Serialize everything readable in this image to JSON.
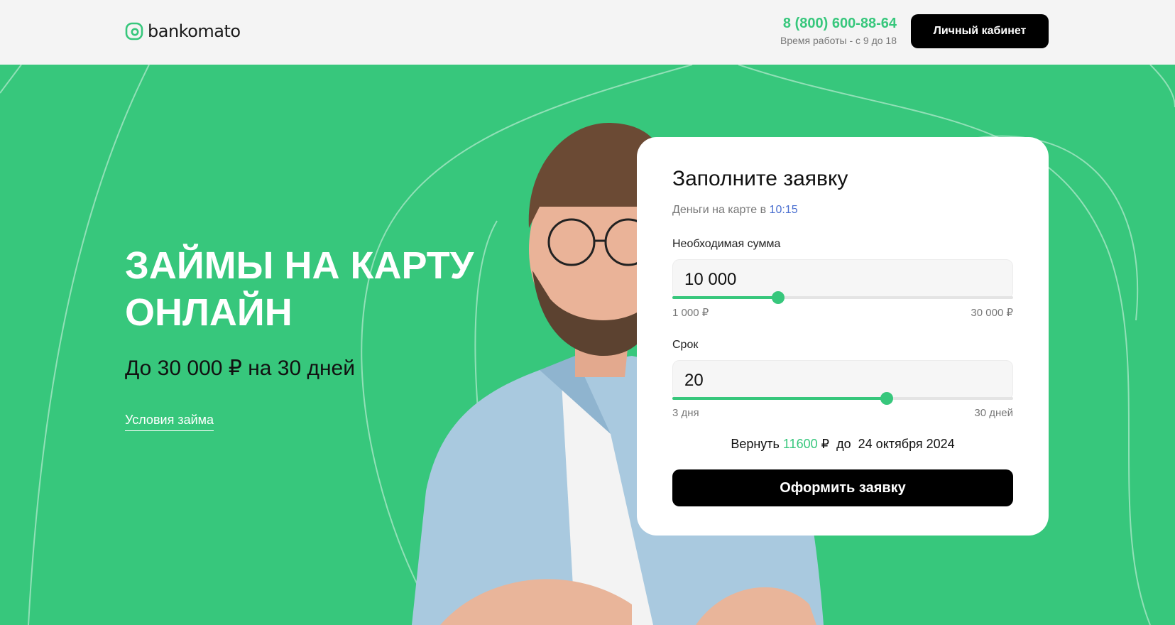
{
  "header": {
    "logo_icon": "bankomato-logo-icon",
    "logo_text": "bankomato",
    "phone": "8 (800) 600-88-64",
    "hours": "Время работы - с 9 до 18",
    "cabinet_label": "Личный кабинет"
  },
  "hero": {
    "title": "ЗАЙМЫ НА КАРТУ ОНЛАЙН",
    "subtitle": "До 30 000 ₽ на 30 дней",
    "terms_link": "Условия займа"
  },
  "form": {
    "title": "Заполните заявку",
    "note_prefix": "Деньги на карте в",
    "note_time": "10:15",
    "amount": {
      "label": "Необходимая сумма",
      "value": "10 000",
      "min_label": "1 000 ₽",
      "max_label": "30 000 ₽",
      "min": 1000,
      "max": 30000,
      "current": 10000
    },
    "term": {
      "label": "Срок",
      "value": "20",
      "min_label": "3 дня",
      "max_label": "30 дней",
      "min": 3,
      "max": 30,
      "current": 20
    },
    "return": {
      "prefix": "Вернуть",
      "amount": "11600",
      "currency": "₽",
      "until": "до",
      "date": "24 октября 2024"
    },
    "submit_label": "Оформить заявку"
  },
  "colors": {
    "accent": "#37c77c",
    "header_bg": "#f4f4f4",
    "button_bg": "#000000",
    "link_time": "#4a6fd0"
  }
}
